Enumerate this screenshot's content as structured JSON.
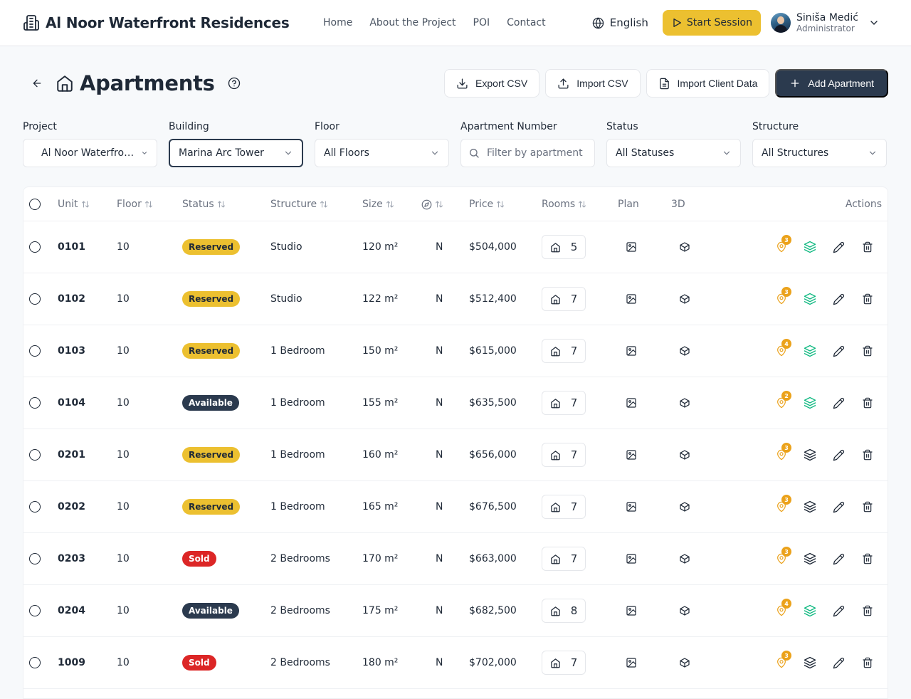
{
  "header": {
    "brand": "Al Noor Waterfront Residences",
    "nav": [
      "Home",
      "About the Project",
      "POI",
      "Contact"
    ],
    "language": "English",
    "start_session": "Start Session",
    "user": {
      "name": "Siniša Medić",
      "role": "Administrator"
    }
  },
  "page": {
    "title": "Apartments",
    "actions": {
      "export_csv": "Export CSV",
      "import_csv": "Import CSV",
      "import_client": "Import Client Data",
      "add": "Add Apartment"
    }
  },
  "filters": {
    "project": {
      "label": "Project",
      "value": "Al Noor Waterfront Residences"
    },
    "building": {
      "label": "Building",
      "value": "Marina Arc Tower"
    },
    "floor": {
      "label": "Floor",
      "value": "All Floors"
    },
    "apartment_number": {
      "label": "Apartment Number",
      "placeholder": "Filter by apartment number"
    },
    "status": {
      "label": "Status",
      "value": "All Statuses"
    },
    "structure": {
      "label": "Structure",
      "value": "All Structures"
    }
  },
  "table": {
    "columns": {
      "unit": "Unit",
      "floor": "Floor",
      "status": "Status",
      "structure": "Structure",
      "size": "Size",
      "price": "Price",
      "rooms": "Rooms",
      "plan": "Plan",
      "3d": "3D",
      "actions": "Actions"
    },
    "status_colors": {
      "Reserved": "#ecc030",
      "Available": "#2b3a4e",
      "Sold": "#dc2626"
    },
    "rows": [
      {
        "unit": "0101",
        "floor": "10",
        "status": "Reserved",
        "structure": "Studio",
        "size": "120 m²",
        "orientation": "N",
        "price": "$504,000",
        "rooms": "5",
        "poi": "3",
        "layers_green": true
      },
      {
        "unit": "0102",
        "floor": "10",
        "status": "Reserved",
        "structure": "Studio",
        "size": "122 m²",
        "orientation": "N",
        "price": "$512,400",
        "rooms": "7",
        "poi": "3",
        "layers_green": true
      },
      {
        "unit": "0103",
        "floor": "10",
        "status": "Reserved",
        "structure": "1 Bedroom",
        "size": "150 m²",
        "orientation": "N",
        "price": "$615,000",
        "rooms": "7",
        "poi": "4",
        "layers_green": true
      },
      {
        "unit": "0104",
        "floor": "10",
        "status": "Available",
        "structure": "1 Bedroom",
        "size": "155 m²",
        "orientation": "N",
        "price": "$635,500",
        "rooms": "7",
        "poi": "2",
        "layers_green": true
      },
      {
        "unit": "0201",
        "floor": "10",
        "status": "Reserved",
        "structure": "1 Bedroom",
        "size": "160 m²",
        "orientation": "N",
        "price": "$656,000",
        "rooms": "7",
        "poi": "3",
        "layers_green": false
      },
      {
        "unit": "0202",
        "floor": "10",
        "status": "Reserved",
        "structure": "1 Bedroom",
        "size": "165 m²",
        "orientation": "N",
        "price": "$676,500",
        "rooms": "7",
        "poi": "3",
        "layers_green": false
      },
      {
        "unit": "0203",
        "floor": "10",
        "status": "Sold",
        "structure": "2 Bedrooms",
        "size": "170 m²",
        "orientation": "N",
        "price": "$663,000",
        "rooms": "7",
        "poi": "3",
        "layers_green": false
      },
      {
        "unit": "0204",
        "floor": "10",
        "status": "Available",
        "structure": "2 Bedrooms",
        "size": "175 m²",
        "orientation": "N",
        "price": "$682,500",
        "rooms": "8",
        "poi": "4",
        "layers_green": true
      },
      {
        "unit": "1009",
        "floor": "10",
        "status": "Sold",
        "structure": "2 Bedrooms",
        "size": "180 m²",
        "orientation": "N",
        "price": "$702,000",
        "rooms": "7",
        "poi": "3",
        "layers_green": false
      }
    ]
  }
}
